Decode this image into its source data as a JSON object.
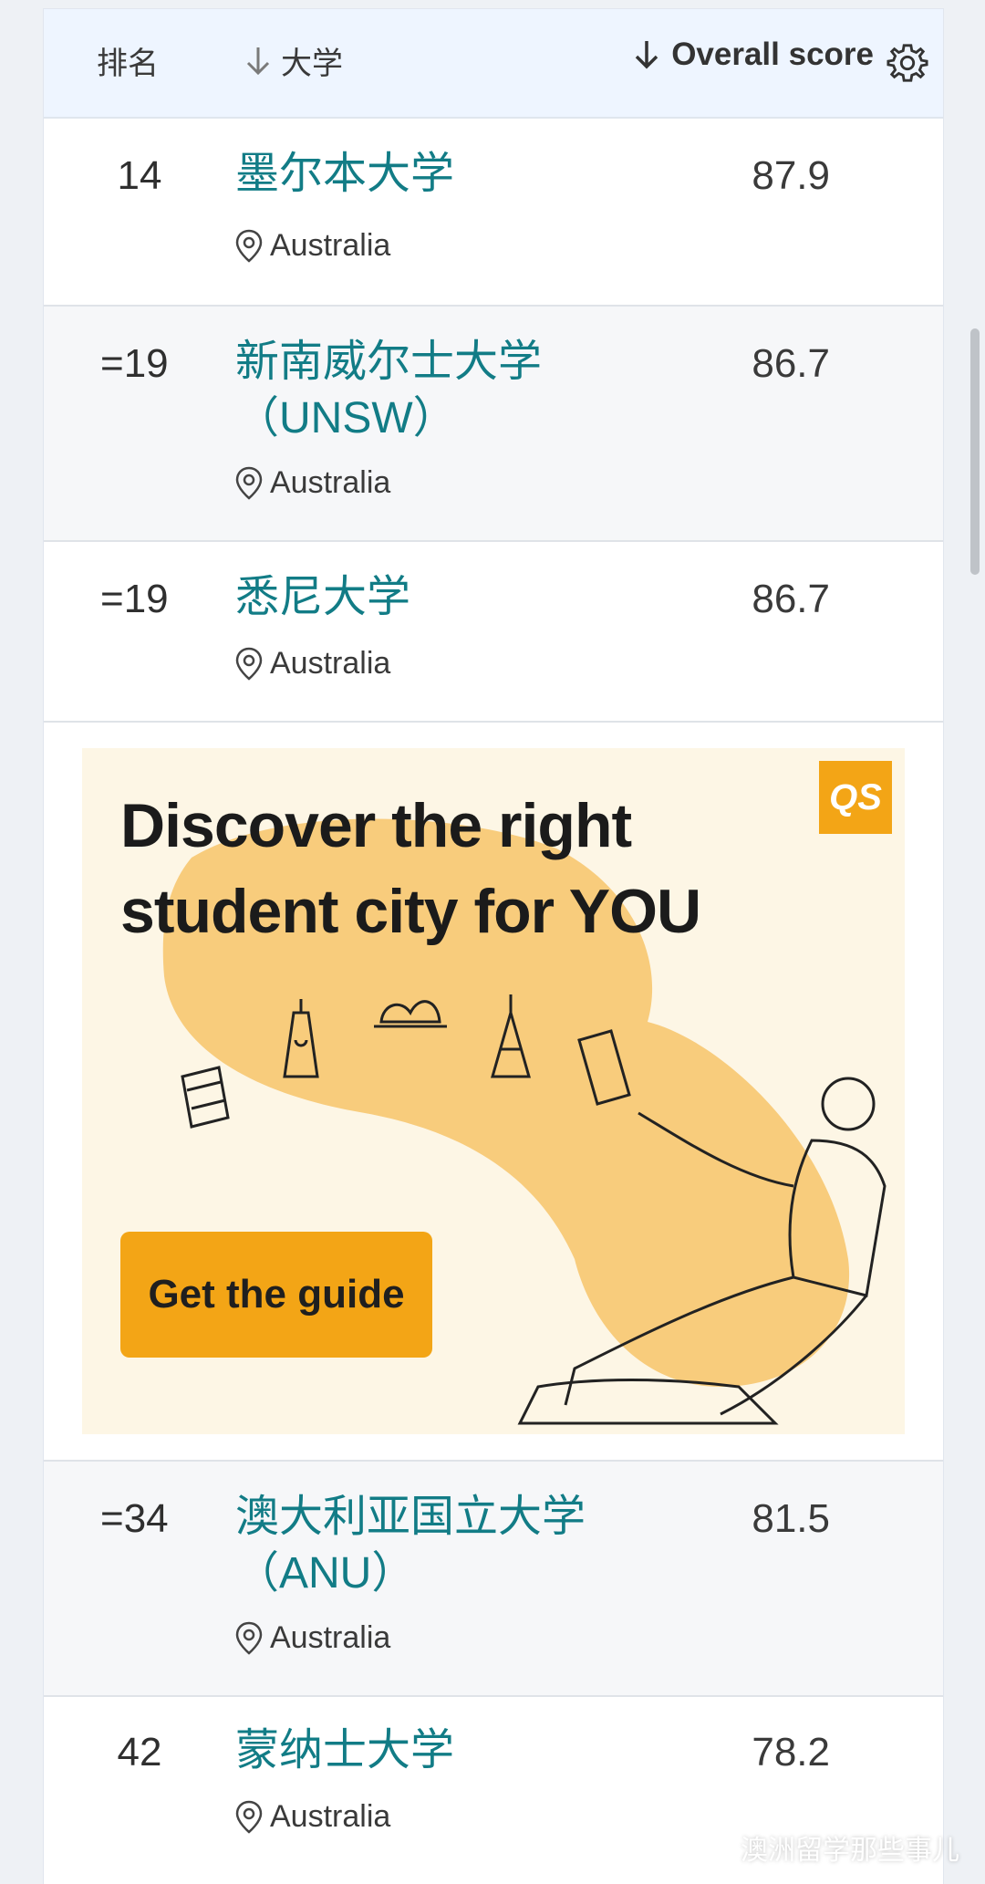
{
  "header": {
    "rank_label": "排名",
    "university_label": "大学",
    "score_label": "Overall score"
  },
  "rows": [
    {
      "rank": "14",
      "name_lines": [
        "墨尔本大学"
      ],
      "country": "Australia",
      "score": "87.9"
    },
    {
      "rank": "=19",
      "name_lines": [
        "新南威尔士大学",
        "（UNSW）"
      ],
      "country": "Australia",
      "score": "86.7"
    },
    {
      "rank": "=19",
      "name_lines": [
        "悉尼大学"
      ],
      "country": "Australia",
      "score": "86.7"
    },
    {
      "rank": "=34",
      "name_lines": [
        "澳大利亚国立大学",
        "（ANU）"
      ],
      "country": "Australia",
      "score": "81.5"
    },
    {
      "rank": "42",
      "name_lines": [
        "蒙纳士大学"
      ],
      "country": "Australia",
      "score": "78.2"
    }
  ],
  "ad": {
    "title_line1": "Discover the right",
    "title_line2": "student city for YOU",
    "logo": "QS",
    "button": "Get the guide"
  },
  "watermark": "澳洲留学那些事儿",
  "colors": {
    "accent": "#127c86",
    "ad_orange": "#f3a516",
    "header_bg": "#eef5ff"
  }
}
